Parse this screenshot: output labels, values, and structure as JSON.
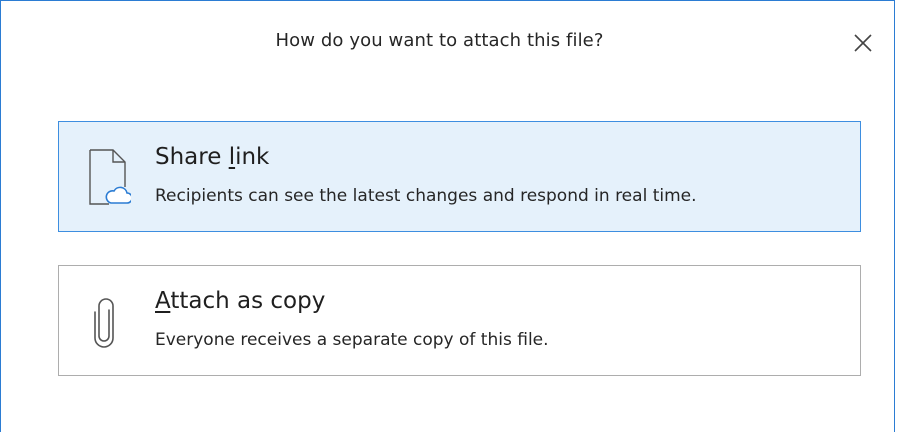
{
  "dialog": {
    "title": "How do you want to attach this file?",
    "close_icon": "close-icon"
  },
  "options": [
    {
      "id": "share-link",
      "title_before": "Share ",
      "title_mnemonic": "l",
      "title_after": "ink",
      "description": "Recipients can see the latest changes and respond in real time.",
      "icon": "cloud-document-icon",
      "selected": true
    },
    {
      "id": "attach-copy",
      "title_before": "",
      "title_mnemonic": "A",
      "title_after": "ttach as copy",
      "description": "Everyone receives a separate copy of this file.",
      "icon": "paperclip-icon",
      "selected": false
    }
  ],
  "colors": {
    "accent_border": "#3d8ee0",
    "selected_bg": "#e5f1fb",
    "window_border": "#2b7cd3",
    "unselected_border": "#adadad"
  }
}
